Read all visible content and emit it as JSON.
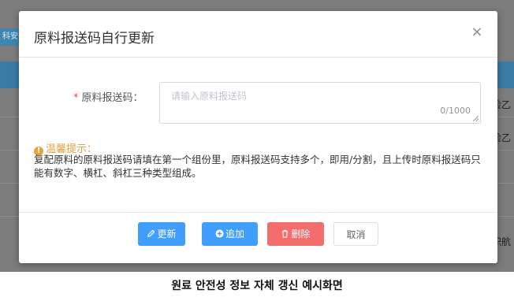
{
  "background": {
    "tab_label": "科安",
    "right_fragments": [
      "险乙",
      "险乙",
      "职航"
    ]
  },
  "dialog": {
    "title": "原料报送码自行更新",
    "close_glyph": "×",
    "field": {
      "required_mark": "*",
      "label": "原料报送码：",
      "placeholder": "请输入原料报送码",
      "value": "",
      "counter": "0/1000"
    },
    "tip": {
      "title": "温馨提示：",
      "icon_glyph": "!",
      "text": "复配原料的原料报送码请填在第一个组份里，原料报送码支持多个，即用/分割，且上传时原料报送码只能有数字、横杠、斜杠三种类型组成。"
    },
    "buttons": {
      "update": "更新",
      "add": "追加",
      "delete": "删除",
      "cancel": "取消"
    }
  },
  "caption": "원료 안전성 정보 자체 갱신 예시화면",
  "colors": {
    "primary": "#409eff",
    "danger": "#f56c6c",
    "warning": "#e6a23c",
    "required": "#e54d42"
  },
  "icons": {
    "update": "edit-icon",
    "add": "plus-circle-icon",
    "delete": "trash-icon",
    "close": "close-icon",
    "tip": "info-icon"
  }
}
